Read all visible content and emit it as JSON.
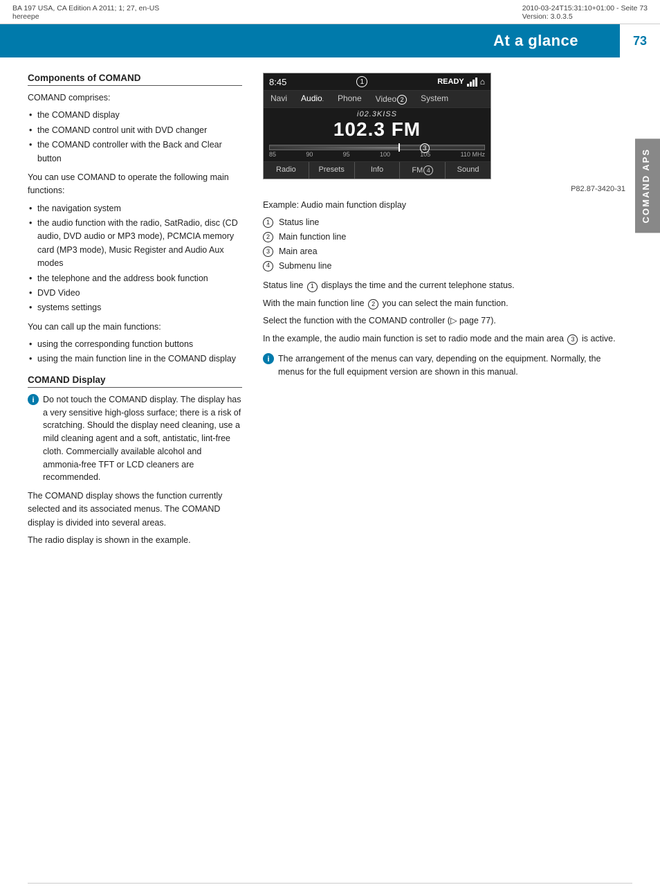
{
  "header": {
    "left_meta": "BA 197 USA, CA Edition A 2011; 1; 27, en-US\nhereepe",
    "left_line1": "BA 197 USA, CA Edition A 2011; 1; 27, en-US",
    "left_line2": "hereepe",
    "right_line1": "2010-03-24T15:31:10+01:00 - Seite 73",
    "right_line2": "Version: 3.0.3.5",
    "title": "At a glance",
    "page_number": "73"
  },
  "sidebar": {
    "label": "COMAND APS"
  },
  "left_col": {
    "section1_heading": "Components of COMAND",
    "para1": "COMAND comprises:",
    "bullets1": [
      "the COMAND display",
      "the COMAND control unit with DVD changer",
      "the COMAND controller with the Back and Clear button"
    ],
    "para2": "You can use COMAND to operate the following main functions:",
    "bullets2": [
      "the navigation system",
      "the audio function with the radio, SatRadio, disc (CD audio, DVD audio or MP3 mode), PCMCIA memory card (MP3 mode), Music Register and Audio Aux modes",
      "the telephone and the address book function",
      "DVD Video",
      "systems settings"
    ],
    "para3": "You can call up the main functions:",
    "bullets3": [
      "using the corresponding function buttons",
      "using the main function line in the COMAND display"
    ],
    "section2_heading": "COMAND Display",
    "info_text": "Do not touch the COMAND display. The display has a very sensitive high-gloss surface; there is a risk of scratching. Should the display need cleaning, use a mild cleaning agent and a soft, antistatic, lint-free cloth. Commercially available alcohol and ammonia-free TFT or LCD cleaners are recommended.",
    "para4": "The COMAND display shows the function currently selected and its associated menus. The COMAND display is divided into several areas.",
    "para5": "The radio display is shown in the example."
  },
  "radio_display": {
    "time": "8:45",
    "circle1": "1",
    "ready": "READY",
    "nav_items": [
      "Navi",
      "Audio",
      "Phone",
      "Video",
      "System"
    ],
    "circle2_nav": "2",
    "station_italic": "i02.3KISS",
    "station_freq": "102.3 FM",
    "circle3": "3",
    "freq_labels": [
      "85",
      "90",
      "95",
      "100",
      "105",
      "110 MHz"
    ],
    "submenu_items": [
      "Radio",
      "Presets",
      "Info",
      "FM",
      "Sound"
    ],
    "circle4": "4",
    "caption": "P82.87-3420-31"
  },
  "right_col": {
    "example_label": "Example: Audio main function display",
    "numbered_items": [
      {
        "num": "1",
        "text": "Status line"
      },
      {
        "num": "2",
        "text": "Main function line"
      },
      {
        "num": "3",
        "text": "Main area"
      },
      {
        "num": "4",
        "text": "Submenu line"
      }
    ],
    "para1": "Status line ① displays the time and the current telephone status.",
    "para2": "With the main function line ② you can select the main function.",
    "para3": "Select the function with the COMAND controller (▷ page 77).",
    "para4": "In the example, the audio main function is set to radio mode and the main area ③ is active.",
    "info_text": "The arrangement of the menus can vary, depending on the equipment. Normally, the menus for the full equipment version are shown in this manual."
  }
}
